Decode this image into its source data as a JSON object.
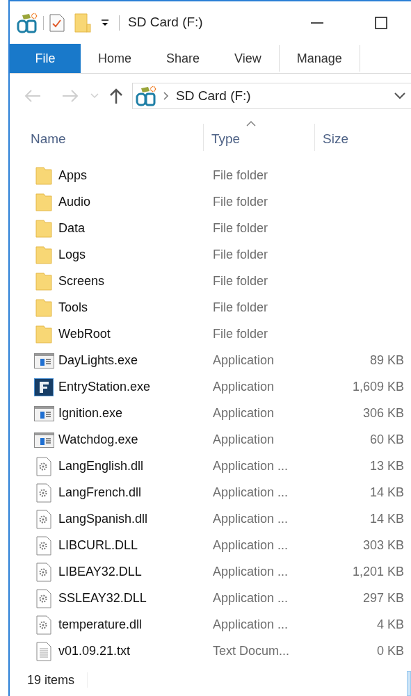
{
  "window": {
    "title": "SD Card (F:)"
  },
  "ribbon_tabs": [
    {
      "label": "File",
      "selected": true
    },
    {
      "label": "Home",
      "selected": false
    },
    {
      "label": "Share",
      "selected": false
    },
    {
      "label": "View",
      "selected": false
    },
    {
      "label": "Manage",
      "selected": false
    }
  ],
  "address_bar": {
    "path": "SD Card (F:)"
  },
  "columns": [
    {
      "label": "Name",
      "sorted": false
    },
    {
      "label": "Type",
      "sorted": true
    },
    {
      "label": "Size",
      "sorted": false
    }
  ],
  "files": [
    {
      "kind": "folder",
      "name": "Apps",
      "type": "File folder"
    },
    {
      "kind": "folder",
      "name": "Audio",
      "type": "File folder"
    },
    {
      "kind": "folder",
      "name": "Data",
      "type": "File folder"
    },
    {
      "kind": "folder",
      "name": "Logs",
      "type": "File folder"
    },
    {
      "kind": "folder",
      "name": "Screens",
      "type": "File folder"
    },
    {
      "kind": "folder",
      "name": "Tools",
      "type": "File folder"
    },
    {
      "kind": "folder",
      "name": "WebRoot",
      "type": "File folder"
    },
    {
      "kind": "exe",
      "name": "DayLights.exe",
      "type": "Application",
      "size": "89 KB"
    },
    {
      "kind": "branded",
      "name": "EntryStation.exe",
      "type": "Application",
      "size": "1,609 KB"
    },
    {
      "kind": "exe",
      "name": "Ignition.exe",
      "type": "Application",
      "size": "306 KB"
    },
    {
      "kind": "exe",
      "name": "Watchdog.exe",
      "type": "Application",
      "size": "60 KB"
    },
    {
      "kind": "dll",
      "name": "LangEnglish.dll",
      "type": "Application ...",
      "size": "13 KB"
    },
    {
      "kind": "dll",
      "name": "LangFrench.dll",
      "type": "Application ...",
      "size": "14 KB"
    },
    {
      "kind": "dll",
      "name": "LangSpanish.dll",
      "type": "Application ...",
      "size": "14 KB"
    },
    {
      "kind": "dll",
      "name": "LIBCURL.DLL",
      "type": "Application ...",
      "size": "303 KB"
    },
    {
      "kind": "dll",
      "name": "LIBEAY32.DLL",
      "type": "Application ...",
      "size": "1,201 KB"
    },
    {
      "kind": "dll",
      "name": "SSLEAY32.DLL",
      "type": "Application ...",
      "size": "297 KB"
    },
    {
      "kind": "dll",
      "name": "temperature.dll",
      "type": "Application ...",
      "size": "4 KB"
    },
    {
      "kind": "txt",
      "name": "v01.09.21.txt",
      "type": "Text Docum...",
      "size": "0 KB"
    }
  ],
  "status_bar": {
    "count": "19 items"
  }
}
